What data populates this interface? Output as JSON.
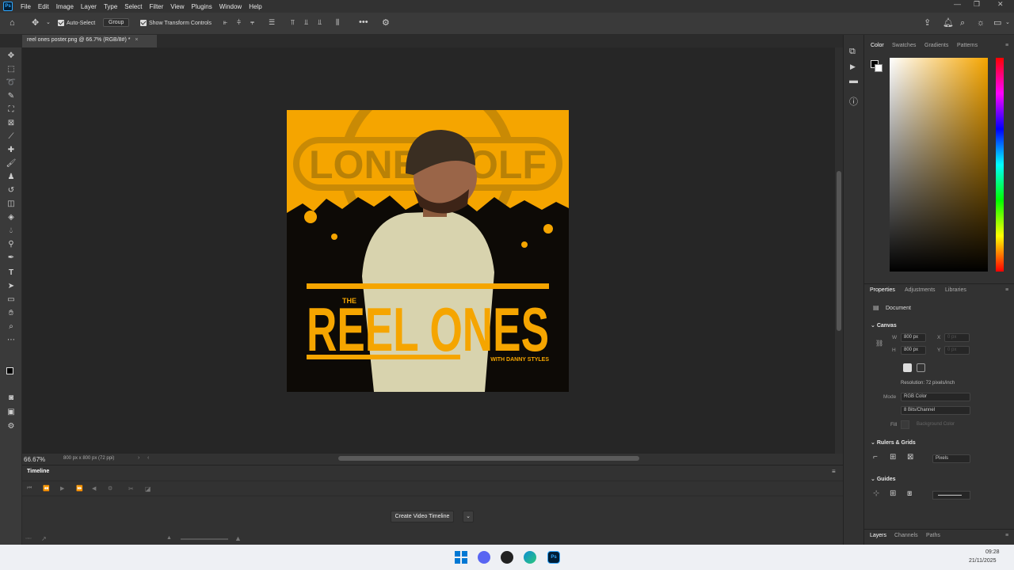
{
  "app": {
    "logo": "Ps"
  },
  "menu": [
    "File",
    "Edit",
    "Image",
    "Layer",
    "Type",
    "Select",
    "Filter",
    "View",
    "Plugins",
    "Window",
    "Help"
  ],
  "options": {
    "auto_select_label": "Auto-Select",
    "auto_select_mode": "Group",
    "transform_label": "Show Transform Controls"
  },
  "document": {
    "tab_title": "reel ones poster.png @ 66.7% (RGB/8#) *",
    "zoom": "66.67%",
    "size_info": "800 px x 800 px (72 ppi)"
  },
  "poster": {
    "brand": "LONE WOLF",
    "the": "THE",
    "title": "REEL ONES",
    "subtitle": "WITH DANNY STYLES"
  },
  "timeline": {
    "tab": "Timeline",
    "create_button": "Create Video Timeline"
  },
  "color_panel": {
    "tabs": [
      "Color",
      "Swatches",
      "Gradients",
      "Patterns"
    ]
  },
  "properties_panel": {
    "tabs": [
      "Properties",
      "Adjustments",
      "Libraries"
    ],
    "doc_label": "Document",
    "canvas_section": "Canvas",
    "w_label": "W",
    "w_value": "800 px",
    "h_label": "H",
    "h_value": "800 px",
    "x_label": "X",
    "x_value": "0 px",
    "y_label": "Y",
    "y_value": "0 px",
    "resolution": "Resolution: 72 pixels/inch",
    "mode_label": "Mode",
    "mode_value": "RGB Color",
    "depth_value": "8 Bits/Channel",
    "fill_label": "Fill",
    "fill_value": "Background Color",
    "rulers_section": "Rulers & Grids",
    "units_value": "Pixels",
    "guides_section": "Guides"
  },
  "layers_panel": {
    "tabs": [
      "Layers",
      "Channels",
      "Paths"
    ]
  },
  "taskbar": {
    "time": "09:28",
    "date": "21/11/2025"
  },
  "colors": {
    "accent": "#f5a500",
    "poster_bg_dark": "#0d0a06",
    "taskbar": "#eef0f4"
  }
}
